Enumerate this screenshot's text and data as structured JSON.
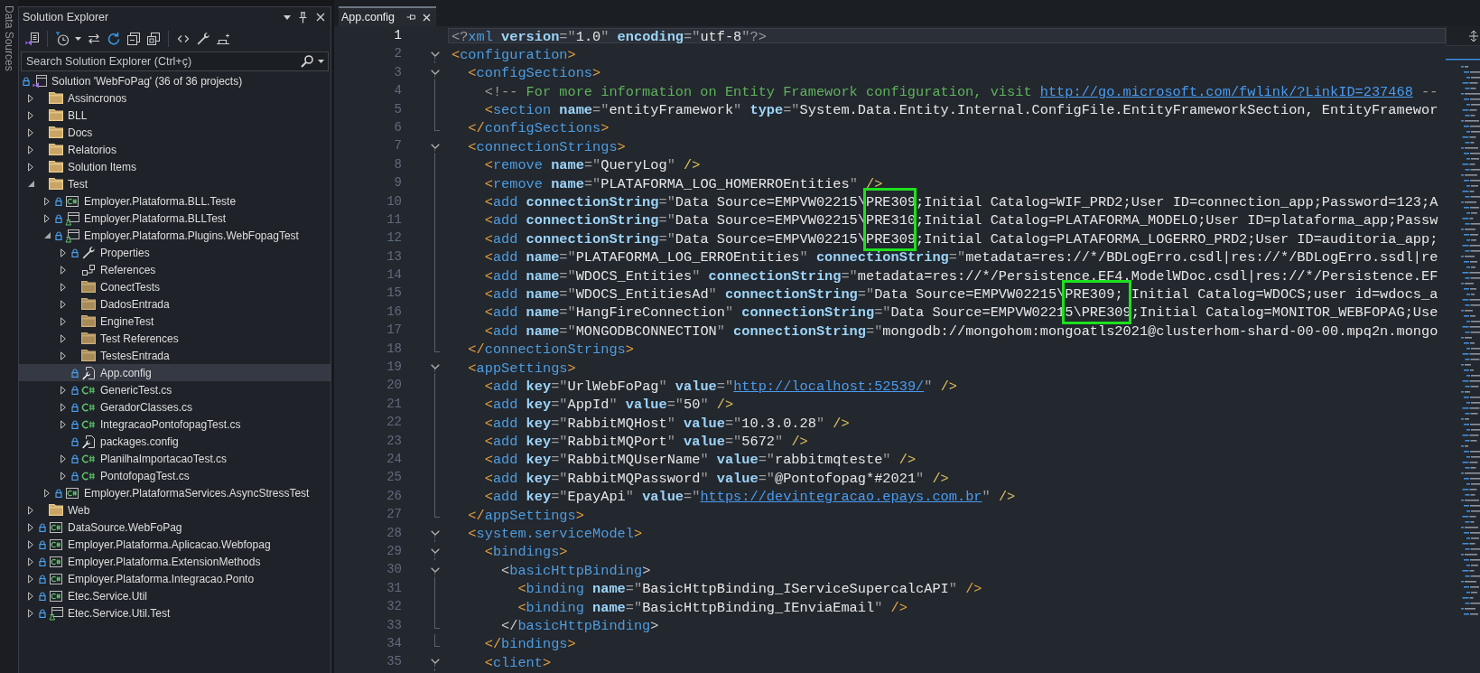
{
  "side_tabs": [
    {
      "label": "Data Sources"
    }
  ],
  "solution_explorer": {
    "title": "Solution Explorer",
    "search": {
      "placeholder": "Search Solution Explorer (Ctrl+ç)"
    },
    "tree": [
      {
        "label": "Solution 'WebFoPag' (36 of 36 projects)",
        "kind": "solution",
        "locked": true,
        "selected": false,
        "children": [
          {
            "label": "Assincronos",
            "kind": "solution-folder",
            "locked": false,
            "expanded": false,
            "selected": false
          },
          {
            "label": "BLL",
            "kind": "solution-folder",
            "locked": false,
            "expanded": false,
            "selected": false
          },
          {
            "label": "Docs",
            "kind": "solution-folder",
            "locked": false,
            "expanded": false,
            "selected": false
          },
          {
            "label": "Relatorios",
            "kind": "solution-folder",
            "locked": false,
            "expanded": false,
            "selected": false
          },
          {
            "label": "Solution Items",
            "kind": "solution-folder",
            "locked": false,
            "expanded": false,
            "selected": false
          },
          {
            "label": "Test",
            "kind": "solution-folder",
            "locked": false,
            "expanded": true,
            "selected": false,
            "children": [
              {
                "label": "Employer.Plataforma.BLL.Teste",
                "kind": "cs-project",
                "locked": true,
                "expanded": false,
                "selected": false
              },
              {
                "label": "Employer.Plataforma.BLLTest",
                "kind": "test-project",
                "locked": true,
                "expanded": false,
                "selected": false
              },
              {
                "label": "Employer.Plataforma.Plugins.WebFopagTest",
                "kind": "test-project",
                "locked": true,
                "expanded": true,
                "selected": false,
                "children": [
                  {
                    "label": "Properties",
                    "kind": "properties",
                    "locked": true,
                    "expanded": false,
                    "selected": false
                  },
                  {
                    "label": "References",
                    "kind": "references",
                    "locked": false,
                    "expanded": false,
                    "selected": false
                  },
                  {
                    "label": "ConectTests",
                    "kind": "folder",
                    "locked": false,
                    "expanded": false,
                    "selected": false
                  },
                  {
                    "label": "DadosEntrada",
                    "kind": "folder",
                    "locked": false,
                    "expanded": false,
                    "selected": false
                  },
                  {
                    "label": "EngineTest",
                    "kind": "folder",
                    "locked": false,
                    "expanded": false,
                    "selected": false
                  },
                  {
                    "label": "Test References",
                    "kind": "folder",
                    "locked": false,
                    "expanded": false,
                    "selected": false
                  },
                  {
                    "label": "TestesEntrada",
                    "kind": "folder",
                    "locked": false,
                    "expanded": false,
                    "selected": false
                  },
                  {
                    "label": "App.config",
                    "kind": "config",
                    "locked": true,
                    "selected": true
                  },
                  {
                    "label": "GenericTest.cs",
                    "kind": "cs-file",
                    "locked": true,
                    "expanded": false,
                    "selected": false
                  },
                  {
                    "label": "GeradorClasses.cs",
                    "kind": "cs-file",
                    "locked": true,
                    "expanded": false,
                    "selected": false
                  },
                  {
                    "label": "IntegracaoPontofopagTest.cs",
                    "kind": "cs-file",
                    "locked": true,
                    "expanded": false,
                    "selected": false
                  },
                  {
                    "label": "packages.config",
                    "kind": "config",
                    "locked": true,
                    "selected": false
                  },
                  {
                    "label": "PlanilhaImportacaoTest.cs",
                    "kind": "cs-file",
                    "locked": true,
                    "expanded": false,
                    "selected": false
                  },
                  {
                    "label": "PontofopagTest.cs",
                    "kind": "cs-file",
                    "locked": true,
                    "expanded": false,
                    "selected": false
                  }
                ]
              },
              {
                "label": "Employer.PlataformaServices.AsyncStressTest",
                "kind": "cs-project",
                "locked": true,
                "expanded": false,
                "selected": false
              }
            ]
          },
          {
            "label": "Web",
            "kind": "solution-folder",
            "locked": false,
            "expanded": false,
            "selected": false
          },
          {
            "label": "DataSource.WebFoPag",
            "kind": "cs-project",
            "locked": true,
            "expanded": false,
            "selected": false
          },
          {
            "label": "Employer.Plataforma.Aplicacao.Webfopag",
            "kind": "cs-project",
            "locked": true,
            "expanded": false,
            "selected": false
          },
          {
            "label": "Employer.Plataforma.ExtensionMethods",
            "kind": "cs-project",
            "locked": true,
            "expanded": false,
            "selected": false
          },
          {
            "label": "Employer.Plataforma.Integracao.Ponto",
            "kind": "cs-project",
            "locked": true,
            "expanded": false,
            "selected": false
          },
          {
            "label": "Etec.Service.Util",
            "kind": "cs-project",
            "locked": true,
            "expanded": false,
            "selected": false
          },
          {
            "label": "Etec.Service.Util.Test",
            "kind": "test-project",
            "locked": true,
            "expanded": false,
            "selected": false
          }
        ]
      }
    ]
  },
  "editor": {
    "tabs": [
      {
        "label": "App.config",
        "selected": true
      }
    ],
    "lines": [
      {
        "number": "1",
        "current": true,
        "kind": "plain",
        "tokens": [
          {
            "text": "<?",
            "kind": "decl"
          },
          {
            "text": "xml ",
            "kind": "tag"
          },
          {
            "text": "version",
            "kind": "attr"
          },
          {
            "text": "=\"",
            "kind": "punct"
          },
          {
            "text": "1.0",
            "kind": "value"
          },
          {
            "text": "\" ",
            "kind": "punct"
          },
          {
            "text": "encoding",
            "kind": "attr"
          },
          {
            "text": "=\"",
            "kind": "punct"
          },
          {
            "text": "utf-8",
            "kind": "value"
          },
          {
            "text": "\"",
            "kind": "punct"
          },
          {
            "text": "?>",
            "kind": "decl"
          }
        ]
      },
      {
        "number": "2",
        "current": false,
        "kind": "opener",
        "tokens": [
          {
            "text": "<",
            "kind": "delim"
          },
          {
            "text": "configuration",
            "kind": "tag"
          },
          {
            "text": ">",
            "kind": "delim"
          }
        ]
      },
      {
        "number": "3",
        "current": false,
        "kind": "opener",
        "tokens": [
          {
            "text": "  <",
            "kind": "delim"
          },
          {
            "text": "configSections",
            "kind": "tag"
          },
          {
            "text": ">",
            "kind": "delim"
          }
        ]
      },
      {
        "number": "4",
        "current": false,
        "kind": "inner",
        "tokens": [
          {
            "text": "    <!--",
            "kind": "comment-delim"
          },
          {
            "text": " For more information on Entity Framework configuration, visit ",
            "kind": "comment"
          },
          {
            "text": "http://go.microsoft.com/fwlink/?LinkID=237468",
            "kind": "link"
          },
          {
            "text": " --",
            "kind": "comment-delim"
          }
        ]
      },
      {
        "number": "5",
        "current": false,
        "kind": "inner",
        "tokens": [
          {
            "text": "    <",
            "kind": "delim"
          },
          {
            "text": "section ",
            "kind": "tag"
          },
          {
            "text": "name",
            "kind": "attr"
          },
          {
            "text": "=\"",
            "kind": "punct"
          },
          {
            "text": "entityFramework",
            "kind": "value"
          },
          {
            "text": "\" ",
            "kind": "punct"
          },
          {
            "text": "type",
            "kind": "attr"
          },
          {
            "text": "=\"",
            "kind": "punct"
          },
          {
            "text": "System.Data.Entity.Internal.ConfigFile.EntityFrameworkSection, EntityFramewor",
            "kind": "value"
          }
        ]
      },
      {
        "number": "6",
        "current": false,
        "kind": "closer",
        "tokens": [
          {
            "text": "  </",
            "kind": "delim"
          },
          {
            "text": "configSections",
            "kind": "tag"
          },
          {
            "text": ">",
            "kind": "delim"
          }
        ]
      },
      {
        "number": "7",
        "current": false,
        "kind": "opener",
        "tokens": [
          {
            "text": "  <",
            "kind": "delim"
          },
          {
            "text": "connectionStrings",
            "kind": "tag"
          },
          {
            "text": ">",
            "kind": "delim"
          }
        ]
      },
      {
        "number": "8",
        "current": false,
        "kind": "inner",
        "tokens": [
          {
            "text": "    <",
            "kind": "delim"
          },
          {
            "text": "remove ",
            "kind": "tag"
          },
          {
            "text": "name",
            "kind": "attr"
          },
          {
            "text": "=\"",
            "kind": "punct"
          },
          {
            "text": "QueryLog",
            "kind": "value"
          },
          {
            "text": "\" ",
            "kind": "punct"
          },
          {
            "text": "/>",
            "kind": "self-close"
          }
        ]
      },
      {
        "number": "9",
        "current": false,
        "kind": "inner",
        "tokens": [
          {
            "text": "    <",
            "kind": "delim"
          },
          {
            "text": "remove ",
            "kind": "tag"
          },
          {
            "text": "name",
            "kind": "attr"
          },
          {
            "text": "=\"",
            "kind": "punct"
          },
          {
            "text": "PLATAFORMA_LOG_HOMERROEntities",
            "kind": "value"
          },
          {
            "text": "\" ",
            "kind": "punct"
          },
          {
            "text": "/>",
            "kind": "self-close"
          }
        ]
      },
      {
        "number": "10",
        "current": false,
        "kind": "inner",
        "tokens": [
          {
            "text": "    <",
            "kind": "delim"
          },
          {
            "text": "add ",
            "kind": "tag"
          },
          {
            "text": "connectionString",
            "kind": "attr"
          },
          {
            "text": "=\"",
            "kind": "punct"
          },
          {
            "text": "Data Source=EMPVW02215\\",
            "kind": "value"
          },
          {
            "text": "PRE309",
            "kind": "value",
            "boxed": true
          },
          {
            "text": ";Initial Catalog=WIF_PRD2;User ID=connection_app;Password=123;A",
            "kind": "value"
          }
        ]
      },
      {
        "number": "11",
        "current": false,
        "kind": "inner",
        "tokens": [
          {
            "text": "    <",
            "kind": "delim"
          },
          {
            "text": "add ",
            "kind": "tag"
          },
          {
            "text": "connectionString",
            "kind": "attr"
          },
          {
            "text": "=\"",
            "kind": "punct"
          },
          {
            "text": "Data Source=EMPVW02215\\",
            "kind": "value"
          },
          {
            "text": "PRE310",
            "kind": "value",
            "boxed": true
          },
          {
            "text": ";Initial Catalog=PLATAFORMA_MODELO;User ID=plataforma_app;Passw",
            "kind": "value"
          }
        ]
      },
      {
        "number": "12",
        "current": false,
        "kind": "inner",
        "tokens": [
          {
            "text": "    <",
            "kind": "delim"
          },
          {
            "text": "add ",
            "kind": "tag"
          },
          {
            "text": "connectionString",
            "kind": "attr"
          },
          {
            "text": "=\"",
            "kind": "punct"
          },
          {
            "text": "Data Source=EMPVW02215\\",
            "kind": "value"
          },
          {
            "text": "PRE309",
            "kind": "value",
            "boxed": true
          },
          {
            "text": ";Initial Catalog=PLATAFORMA_LOGERRO_PRD2;User ID=auditoria_app;",
            "kind": "value"
          }
        ]
      },
      {
        "number": "13",
        "current": false,
        "kind": "inner",
        "tokens": [
          {
            "text": "    <",
            "kind": "delim"
          },
          {
            "text": "add ",
            "kind": "tag"
          },
          {
            "text": "name",
            "kind": "attr"
          },
          {
            "text": "=\"",
            "kind": "punct"
          },
          {
            "text": "PLATAFORMA_LOG_ERROEntities",
            "kind": "value"
          },
          {
            "text": "\" ",
            "kind": "punct"
          },
          {
            "text": "connectionString",
            "kind": "attr"
          },
          {
            "text": "=\"",
            "kind": "punct"
          },
          {
            "text": "metadata=res://*/BDLogErro.csdl|res://*/BDLogErro.ssdl|re",
            "kind": "value"
          }
        ]
      },
      {
        "number": "14",
        "current": false,
        "kind": "inner",
        "tokens": [
          {
            "text": "    <",
            "kind": "delim"
          },
          {
            "text": "add ",
            "kind": "tag"
          },
          {
            "text": "name",
            "kind": "attr"
          },
          {
            "text": "=\"",
            "kind": "punct"
          },
          {
            "text": "WDOCS_Entities",
            "kind": "value"
          },
          {
            "text": "\" ",
            "kind": "punct"
          },
          {
            "text": "connectionString",
            "kind": "attr"
          },
          {
            "text": "=\"",
            "kind": "punct"
          },
          {
            "text": "metadata=res://*/Persistence.EF4.ModelWDoc.csdl|res://*/Persistence.EF",
            "kind": "value"
          }
        ]
      },
      {
        "number": "15",
        "current": false,
        "kind": "inner",
        "tokens": [
          {
            "text": "    <",
            "kind": "delim"
          },
          {
            "text": "add ",
            "kind": "tag"
          },
          {
            "text": "name",
            "kind": "attr"
          },
          {
            "text": "=\"",
            "kind": "punct"
          },
          {
            "text": "WDOCS_EntitiesAd",
            "kind": "value"
          },
          {
            "text": "\" ",
            "kind": "punct"
          },
          {
            "text": "connectionString",
            "kind": "attr"
          },
          {
            "text": "=\"",
            "kind": "punct"
          },
          {
            "text": "Data Source=EMPVW02215\\",
            "kind": "value"
          },
          {
            "text": "PRE309",
            "kind": "value",
            "boxed": true
          },
          {
            "text": "; Initial Catalog=WDOCS;user id=wdocs_a",
            "kind": "value"
          }
        ]
      },
      {
        "number": "16",
        "current": false,
        "kind": "inner",
        "tokens": [
          {
            "text": "    <",
            "kind": "delim"
          },
          {
            "text": "add ",
            "kind": "tag"
          },
          {
            "text": "name",
            "kind": "attr"
          },
          {
            "text": "=\"",
            "kind": "punct"
          },
          {
            "text": "HangFireConnection",
            "kind": "value"
          },
          {
            "text": "\" ",
            "kind": "punct"
          },
          {
            "text": "connectionString",
            "kind": "attr"
          },
          {
            "text": "=\"",
            "kind": "punct"
          },
          {
            "text": "Data Source=EMPVW02215\\",
            "kind": "value"
          },
          {
            "text": "PRE309",
            "kind": "value",
            "boxed": true
          },
          {
            "text": ";Initial Catalog=MONITOR_WEBFOPAG;Use",
            "kind": "value"
          }
        ]
      },
      {
        "number": "17",
        "current": false,
        "kind": "inner",
        "tokens": [
          {
            "text": "    <",
            "kind": "delim"
          },
          {
            "text": "add ",
            "kind": "tag"
          },
          {
            "text": "name",
            "kind": "attr"
          },
          {
            "text": "=\"",
            "kind": "punct"
          },
          {
            "text": "MONGODBCONNECTION",
            "kind": "value"
          },
          {
            "text": "\" ",
            "kind": "punct"
          },
          {
            "text": "connectionString",
            "kind": "attr"
          },
          {
            "text": "=\"",
            "kind": "punct"
          },
          {
            "text": "mongodb://mongohom:mongoatls2021@clusterhom-shard-00-00.mpq2n.mongo",
            "kind": "value"
          }
        ]
      },
      {
        "number": "18",
        "current": false,
        "kind": "closer",
        "tokens": [
          {
            "text": "  </",
            "kind": "delim"
          },
          {
            "text": "connectionStrings",
            "kind": "tag"
          },
          {
            "text": ">",
            "kind": "delim"
          }
        ]
      },
      {
        "number": "19",
        "current": false,
        "kind": "opener",
        "tokens": [
          {
            "text": "  <",
            "kind": "delim"
          },
          {
            "text": "appSettings",
            "kind": "tag"
          },
          {
            "text": ">",
            "kind": "delim"
          }
        ]
      },
      {
        "number": "20",
        "current": false,
        "kind": "inner",
        "tokens": [
          {
            "text": "    <",
            "kind": "delim"
          },
          {
            "text": "add ",
            "kind": "tag"
          },
          {
            "text": "key",
            "kind": "attr"
          },
          {
            "text": "=\"",
            "kind": "punct"
          },
          {
            "text": "UrlWebFoPag",
            "kind": "value"
          },
          {
            "text": "\" ",
            "kind": "punct"
          },
          {
            "text": "value",
            "kind": "attr"
          },
          {
            "text": "=\"",
            "kind": "punct"
          },
          {
            "text": "http://localhost:52539/",
            "kind": "link"
          },
          {
            "text": "\" ",
            "kind": "punct"
          },
          {
            "text": "/>",
            "kind": "self-close"
          }
        ]
      },
      {
        "number": "21",
        "current": false,
        "kind": "inner",
        "tokens": [
          {
            "text": "    <",
            "kind": "delim"
          },
          {
            "text": "add ",
            "kind": "tag"
          },
          {
            "text": "key",
            "kind": "attr"
          },
          {
            "text": "=\"",
            "kind": "punct"
          },
          {
            "text": "AppId",
            "kind": "value"
          },
          {
            "text": "\" ",
            "kind": "punct"
          },
          {
            "text": "value",
            "kind": "attr"
          },
          {
            "text": "=\"",
            "kind": "punct"
          },
          {
            "text": "50",
            "kind": "value"
          },
          {
            "text": "\" ",
            "kind": "punct"
          },
          {
            "text": "/>",
            "kind": "self-close"
          }
        ]
      },
      {
        "number": "22",
        "current": false,
        "kind": "inner",
        "tokens": [
          {
            "text": "    <",
            "kind": "delim"
          },
          {
            "text": "add ",
            "kind": "tag"
          },
          {
            "text": "key",
            "kind": "attr"
          },
          {
            "text": "=\"",
            "kind": "punct"
          },
          {
            "text": "RabbitMQHost",
            "kind": "value"
          },
          {
            "text": "\" ",
            "kind": "punct"
          },
          {
            "text": "value",
            "kind": "attr"
          },
          {
            "text": "=\"",
            "kind": "punct"
          },
          {
            "text": "10.3.0.28",
            "kind": "value"
          },
          {
            "text": "\" ",
            "kind": "punct"
          },
          {
            "text": "/>",
            "kind": "self-close"
          }
        ]
      },
      {
        "number": "23",
        "current": false,
        "kind": "inner",
        "tokens": [
          {
            "text": "    <",
            "kind": "delim"
          },
          {
            "text": "add ",
            "kind": "tag"
          },
          {
            "text": "key",
            "kind": "attr"
          },
          {
            "text": "=\"",
            "kind": "punct"
          },
          {
            "text": "RabbitMQPort",
            "kind": "value"
          },
          {
            "text": "\" ",
            "kind": "punct"
          },
          {
            "text": "value",
            "kind": "attr"
          },
          {
            "text": "=\"",
            "kind": "punct"
          },
          {
            "text": "5672",
            "kind": "value"
          },
          {
            "text": "\" ",
            "kind": "punct"
          },
          {
            "text": "/>",
            "kind": "self-close"
          }
        ]
      },
      {
        "number": "24",
        "current": false,
        "kind": "inner",
        "tokens": [
          {
            "text": "    <",
            "kind": "delim"
          },
          {
            "text": "add ",
            "kind": "tag"
          },
          {
            "text": "key",
            "kind": "attr"
          },
          {
            "text": "=\"",
            "kind": "punct"
          },
          {
            "text": "RabbitMQUserName",
            "kind": "value"
          },
          {
            "text": "\" ",
            "kind": "punct"
          },
          {
            "text": "value",
            "kind": "attr"
          },
          {
            "text": "=\"",
            "kind": "punct"
          },
          {
            "text": "rabbitmqteste",
            "kind": "value"
          },
          {
            "text": "\" ",
            "kind": "punct"
          },
          {
            "text": "/>",
            "kind": "self-close"
          }
        ]
      },
      {
        "number": "25",
        "current": false,
        "kind": "inner",
        "tokens": [
          {
            "text": "    <",
            "kind": "delim"
          },
          {
            "text": "add ",
            "kind": "tag"
          },
          {
            "text": "key",
            "kind": "attr"
          },
          {
            "text": "=\"",
            "kind": "punct"
          },
          {
            "text": "RabbitMQPassword",
            "kind": "value"
          },
          {
            "text": "\" ",
            "kind": "punct"
          },
          {
            "text": "value",
            "kind": "attr"
          },
          {
            "text": "=\"",
            "kind": "punct"
          },
          {
            "text": "@Pontofopag*#2021",
            "kind": "value"
          },
          {
            "text": "\" ",
            "kind": "punct"
          },
          {
            "text": "/>",
            "kind": "self-close"
          }
        ]
      },
      {
        "number": "26",
        "current": false,
        "kind": "inner",
        "tokens": [
          {
            "text": "    <",
            "kind": "delim"
          },
          {
            "text": "add ",
            "kind": "tag"
          },
          {
            "text": "key",
            "kind": "attr"
          },
          {
            "text": "=\"",
            "kind": "punct"
          },
          {
            "text": "EpayApi",
            "kind": "value"
          },
          {
            "text": "\" ",
            "kind": "punct"
          },
          {
            "text": "value",
            "kind": "attr"
          },
          {
            "text": "=\"",
            "kind": "punct"
          },
          {
            "text": "https://devintegracao.epays.com.br",
            "kind": "link"
          },
          {
            "text": "\" ",
            "kind": "punct"
          },
          {
            "text": "/>",
            "kind": "self-close"
          }
        ]
      },
      {
        "number": "27",
        "current": false,
        "kind": "closer",
        "tokens": [
          {
            "text": "  </",
            "kind": "delim"
          },
          {
            "text": "appSettings",
            "kind": "tag"
          },
          {
            "text": ">",
            "kind": "delim"
          }
        ]
      },
      {
        "number": "28",
        "current": false,
        "kind": "opener",
        "tokens": [
          {
            "text": "  <",
            "kind": "delim"
          },
          {
            "text": "system.serviceModel",
            "kind": "tag"
          },
          {
            "text": ">",
            "kind": "delim"
          }
        ]
      },
      {
        "number": "29",
        "current": false,
        "kind": "opener",
        "tokens": [
          {
            "text": "    <",
            "kind": "delim"
          },
          {
            "text": "bindings",
            "kind": "tag"
          },
          {
            "text": ">",
            "kind": "delim"
          }
        ]
      },
      {
        "number": "30",
        "current": false,
        "kind": "opener",
        "tokens": [
          {
            "text": "      <",
            "kind": "delim-plain"
          },
          {
            "text": "basicHttpBinding",
            "kind": "tag"
          },
          {
            "text": ">",
            "kind": "delim-plain"
          }
        ]
      },
      {
        "number": "31",
        "current": false,
        "kind": "inner",
        "tokens": [
          {
            "text": "        <",
            "kind": "delim"
          },
          {
            "text": "binding ",
            "kind": "tag"
          },
          {
            "text": "name",
            "kind": "attr"
          },
          {
            "text": "=\"",
            "kind": "punct"
          },
          {
            "text": "BasicHttpBinding_IServiceSupercalcAPI",
            "kind": "value"
          },
          {
            "text": "\" ",
            "kind": "punct"
          },
          {
            "text": "/>",
            "kind": "delim"
          }
        ]
      },
      {
        "number": "32",
        "current": false,
        "kind": "inner",
        "tokens": [
          {
            "text": "        <",
            "kind": "delim"
          },
          {
            "text": "binding ",
            "kind": "tag"
          },
          {
            "text": "name",
            "kind": "attr"
          },
          {
            "text": "=\"",
            "kind": "punct"
          },
          {
            "text": "BasicHttpBinding_IEnviaEmail",
            "kind": "value"
          },
          {
            "text": "\" ",
            "kind": "punct"
          },
          {
            "text": "/>",
            "kind": "delim"
          }
        ]
      },
      {
        "number": "33",
        "current": false,
        "kind": "closer",
        "tokens": [
          {
            "text": "      </",
            "kind": "delim-plain"
          },
          {
            "text": "basicHttpBinding",
            "kind": "tag"
          },
          {
            "text": ">",
            "kind": "delim-plain"
          }
        ]
      },
      {
        "number": "34",
        "current": false,
        "kind": "closer",
        "tokens": [
          {
            "text": "    </",
            "kind": "delim"
          },
          {
            "text": "bindings",
            "kind": "tag"
          },
          {
            "text": ">",
            "kind": "delim"
          }
        ]
      },
      {
        "number": "35",
        "current": false,
        "kind": "opener",
        "tokens": [
          {
            "text": "    <",
            "kind": "delim"
          },
          {
            "text": "client",
            "kind": "tag"
          },
          {
            "text": ">",
            "kind": "delim"
          }
        ]
      }
    ]
  }
}
